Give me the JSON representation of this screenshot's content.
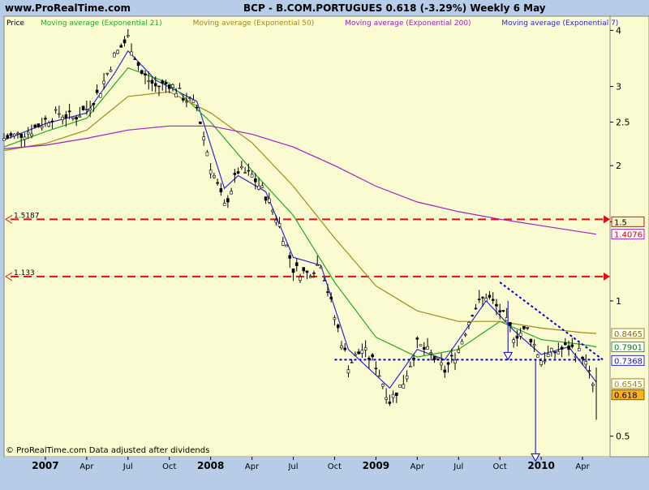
{
  "header": {
    "site": "www.ProRealTime.com",
    "title": "BCP - B.COM.PORTUGUES    0.618 (-3.29%)    Weekly  6 May"
  },
  "legend": [
    {
      "label": "Price",
      "color": "#000000"
    },
    {
      "label": "Moving average (Exponential 21)",
      "color": "#22aa22"
    },
    {
      "label": "Moving average (Exponential 50)",
      "color": "#a08a1a"
    },
    {
      "label": "Moving average (Exponential 200)",
      "color": "#a020c0"
    },
    {
      "label": "Moving average (Exponential 7)",
      "color": "#2a2ad0"
    },
    {
      "label": "Movi",
      "color": "#a08a1a"
    }
  ],
  "footer": "© ProRealTime.com  Data adjusted after dividends",
  "chart_data": {
    "type": "line",
    "y_scale": "log",
    "ylim": [
      0.45,
      4.3
    ],
    "yticks": [
      {
        "v": 4,
        "label": "4"
      },
      {
        "v": 3,
        "label": "3"
      },
      {
        "v": 2.5,
        "label": "2.5"
      },
      {
        "v": 2,
        "label": "2"
      },
      {
        "v": 1.5,
        "label": "1.5"
      },
      {
        "v": 1,
        "label": "1"
      },
      {
        "v": 0.5,
        "label": "0.5"
      }
    ],
    "xticks": [
      {
        "label": "2007",
        "bold": true
      },
      {
        "label": "Apr",
        "bold": false
      },
      {
        "label": "Jul",
        "bold": false
      },
      {
        "label": "Oct",
        "bold": false
      },
      {
        "label": "2008",
        "bold": true
      },
      {
        "label": "Apr",
        "bold": false
      },
      {
        "label": "Jul",
        "bold": false
      },
      {
        "label": "Oct",
        "bold": false
      },
      {
        "label": "2009",
        "bold": true
      },
      {
        "label": "Apr",
        "bold": false
      },
      {
        "label": "Jul",
        "bold": false
      },
      {
        "label": "Oct",
        "bold": false
      },
      {
        "label": "2010",
        "bold": true
      },
      {
        "label": "Apr",
        "bold": false
      }
    ],
    "xlim": [
      "2006-10",
      "2010-06"
    ],
    "series": [
      {
        "name": "Price",
        "color": "#000000",
        "points": [
          [
            "2006-10",
            2.3
          ],
          [
            "2006-11",
            2.34
          ],
          [
            "2006-12",
            2.4
          ],
          [
            "2007-01",
            2.52
          ],
          [
            "2007-02",
            2.62
          ],
          [
            "2007-03",
            2.55
          ],
          [
            "2007-04",
            2.68
          ],
          [
            "2007-05",
            2.95
          ],
          [
            "2007-06",
            3.5
          ],
          [
            "2007-07",
            3.85
          ],
          [
            "2007-08",
            3.2
          ],
          [
            "2007-09",
            3.0
          ],
          [
            "2007-10",
            3.05
          ],
          [
            "2007-11",
            2.85
          ],
          [
            "2007-12",
            2.7
          ],
          [
            "2008-01",
            2.0
          ],
          [
            "2008-02",
            1.62
          ],
          [
            "2008-03",
            1.95
          ],
          [
            "2008-04",
            1.9
          ],
          [
            "2008-05",
            1.72
          ],
          [
            "2008-06",
            1.48
          ],
          [
            "2008-07",
            1.18
          ],
          [
            "2008-08",
            1.15
          ],
          [
            "2008-09",
            1.22
          ],
          [
            "2008-10",
            0.92
          ],
          [
            "2008-11",
            0.72
          ],
          [
            "2008-12",
            0.78
          ],
          [
            "2009-01",
            0.72
          ],
          [
            "2009-02",
            0.6
          ],
          [
            "2009-03",
            0.66
          ],
          [
            "2009-04",
            0.8
          ],
          [
            "2009-05",
            0.76
          ],
          [
            "2009-06",
            0.7
          ],
          [
            "2009-07",
            0.78
          ],
          [
            "2009-08",
            0.95
          ],
          [
            "2009-09",
            1.03
          ],
          [
            "2009-10",
            0.95
          ],
          [
            "2009-11",
            0.84
          ],
          [
            "2009-12",
            0.86
          ],
          [
            "2010-01",
            0.74
          ],
          [
            "2010-02",
            0.77
          ],
          [
            "2010-03",
            0.79
          ],
          [
            "2010-04",
            0.76
          ],
          [
            "2010-05",
            0.618
          ]
        ]
      },
      {
        "name": "Moving average (Exponential 7)",
        "color": "#2a2ad0",
        "points": [
          [
            "2006-10",
            2.28
          ],
          [
            "2007-01",
            2.48
          ],
          [
            "2007-04",
            2.62
          ],
          [
            "2007-06",
            3.2
          ],
          [
            "2007-07",
            3.6
          ],
          [
            "2007-09",
            3.1
          ],
          [
            "2007-12",
            2.78
          ],
          [
            "2008-02",
            1.78
          ],
          [
            "2008-03",
            1.9
          ],
          [
            "2008-05",
            1.75
          ],
          [
            "2008-07",
            1.25
          ],
          [
            "2008-09",
            1.2
          ],
          [
            "2008-11",
            0.78
          ],
          [
            "2009-02",
            0.64
          ],
          [
            "2009-04",
            0.78
          ],
          [
            "2009-06",
            0.74
          ],
          [
            "2009-09",
            1.0
          ],
          [
            "2009-11",
            0.86
          ],
          [
            "2010-01",
            0.76
          ],
          [
            "2010-03",
            0.79
          ],
          [
            "2010-05",
            0.66
          ]
        ]
      },
      {
        "name": "Moving average (Exponential 21)",
        "color": "#22aa22",
        "points": [
          [
            "2006-10",
            2.2
          ],
          [
            "2007-01",
            2.38
          ],
          [
            "2007-04",
            2.55
          ],
          [
            "2007-07",
            3.3
          ],
          [
            "2007-10",
            3.05
          ],
          [
            "2008-01",
            2.5
          ],
          [
            "2008-04",
            1.95
          ],
          [
            "2008-07",
            1.55
          ],
          [
            "2008-10",
            1.1
          ],
          [
            "2009-01",
            0.83
          ],
          [
            "2009-04",
            0.75
          ],
          [
            "2009-07",
            0.78
          ],
          [
            "2009-10",
            0.9
          ],
          [
            "2010-01",
            0.82
          ],
          [
            "2010-04",
            0.8
          ],
          [
            "2010-05",
            0.79
          ]
        ]
      },
      {
        "name": "Moving average (Exponential 50)",
        "color": "#a08a1a",
        "points": [
          [
            "2006-10",
            2.16
          ],
          [
            "2007-01",
            2.24
          ],
          [
            "2007-04",
            2.4
          ],
          [
            "2007-07",
            2.85
          ],
          [
            "2007-10",
            2.92
          ],
          [
            "2008-01",
            2.62
          ],
          [
            "2008-04",
            2.25
          ],
          [
            "2008-07",
            1.8
          ],
          [
            "2008-10",
            1.38
          ],
          [
            "2009-01",
            1.08
          ],
          [
            "2009-04",
            0.95
          ],
          [
            "2009-07",
            0.9
          ],
          [
            "2009-10",
            0.9
          ],
          [
            "2010-01",
            0.87
          ],
          [
            "2010-04",
            0.85
          ],
          [
            "2010-05",
            0.8465
          ]
        ]
      },
      {
        "name": "Moving average (Exponential 200)",
        "color": "#a020c0",
        "points": [
          [
            "2006-10",
            2.18
          ],
          [
            "2007-01",
            2.22
          ],
          [
            "2007-04",
            2.3
          ],
          [
            "2007-07",
            2.4
          ],
          [
            "2007-10",
            2.45
          ],
          [
            "2008-01",
            2.45
          ],
          [
            "2008-04",
            2.35
          ],
          [
            "2008-07",
            2.2
          ],
          [
            "2008-10",
            2.0
          ],
          [
            "2009-01",
            1.8
          ],
          [
            "2009-04",
            1.66
          ],
          [
            "2009-07",
            1.58
          ],
          [
            "2009-10",
            1.52
          ],
          [
            "2010-01",
            1.47
          ],
          [
            "2010-05",
            1.4076
          ]
        ]
      }
    ],
    "horizontal_lines": [
      {
        "value": 1.5187,
        "label": "1.5187",
        "color": "#dd1111"
      },
      {
        "value": 1.133,
        "label": "1.133",
        "color": "#dd1111"
      },
      {
        "value": 0.74,
        "label": "",
        "color": "#0000cc"
      }
    ],
    "trendline": {
      "from": [
        "2009-10",
        1.1
      ],
      "to": [
        "2010-05",
        0.74
      ],
      "color": "#0000cc"
    },
    "arrows": [
      {
        "x": "2009-10",
        "from": 1.0,
        "to": 0.74
      },
      {
        "x": "2009-12",
        "from": 0.74,
        "to": 0.44
      }
    ],
    "right_labels": [
      {
        "value": 1.5,
        "label": "1.5",
        "bg": "#f5f5c8",
        "fg": "#000000",
        "border": "#dd1111"
      },
      {
        "value": 1.4076,
        "label": "1.4076",
        "bg": "#ffffff",
        "fg": "#cc0000",
        "border": "#a020c0"
      },
      {
        "value": 0.8465,
        "label": "0.8465",
        "bg": "#ffffff",
        "fg": "#806a00",
        "border": "#a08a1a"
      },
      {
        "value": 0.7901,
        "label": "0.7901",
        "bg": "#ffffff",
        "fg": "#117711",
        "border": "#22aa22"
      },
      {
        "value": 0.7368,
        "label": "0.7368",
        "bg": "#ffffff",
        "fg": "#1a1aa0",
        "border": "#2a2ad0"
      },
      {
        "value": 0.6545,
        "label": "0.6545",
        "bg": "#ffffff",
        "fg": "#a08a1a",
        "border": "#a08a1a"
      },
      {
        "value": 0.618,
        "label": "0.618",
        "bg": "#ffb020",
        "fg": "#000000",
        "border": "#806000"
      }
    ]
  }
}
